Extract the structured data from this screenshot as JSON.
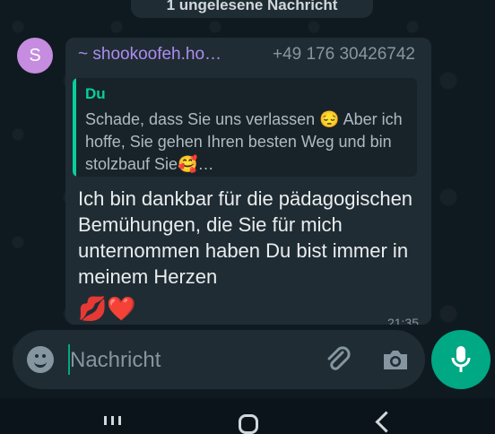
{
  "banner": {
    "text": "1 ungelesene Nachricht"
  },
  "message": {
    "avatar_letter": "S",
    "sender_name": "~ shookoofeh.ho…",
    "sender_phone": "+49 176 30426742",
    "quote_author": "Du",
    "quote_text": "Schade, dass Sie uns verlassen 😔 Aber ich hoffe,  Sie gehen Ihren besten Weg und bin stolzbauf Sie🥰…",
    "body": "Ich bin dankbar für die pädagogischen Bemühungen, die Sie für mich unternommen haben Du bist immer in meinem Herzen",
    "emojis": "💋❤️",
    "time": "21:35"
  },
  "composer": {
    "placeholder": "Nachricht"
  },
  "colors": {
    "accent": "#00a884",
    "sender": "#ad8cf2",
    "quote_author": "#06cf9c",
    "bubble": "#202c33"
  },
  "icons": [
    "emoji-icon",
    "attach-icon",
    "camera-icon",
    "mic-icon",
    "recents-icon",
    "home-icon",
    "back-icon"
  ]
}
